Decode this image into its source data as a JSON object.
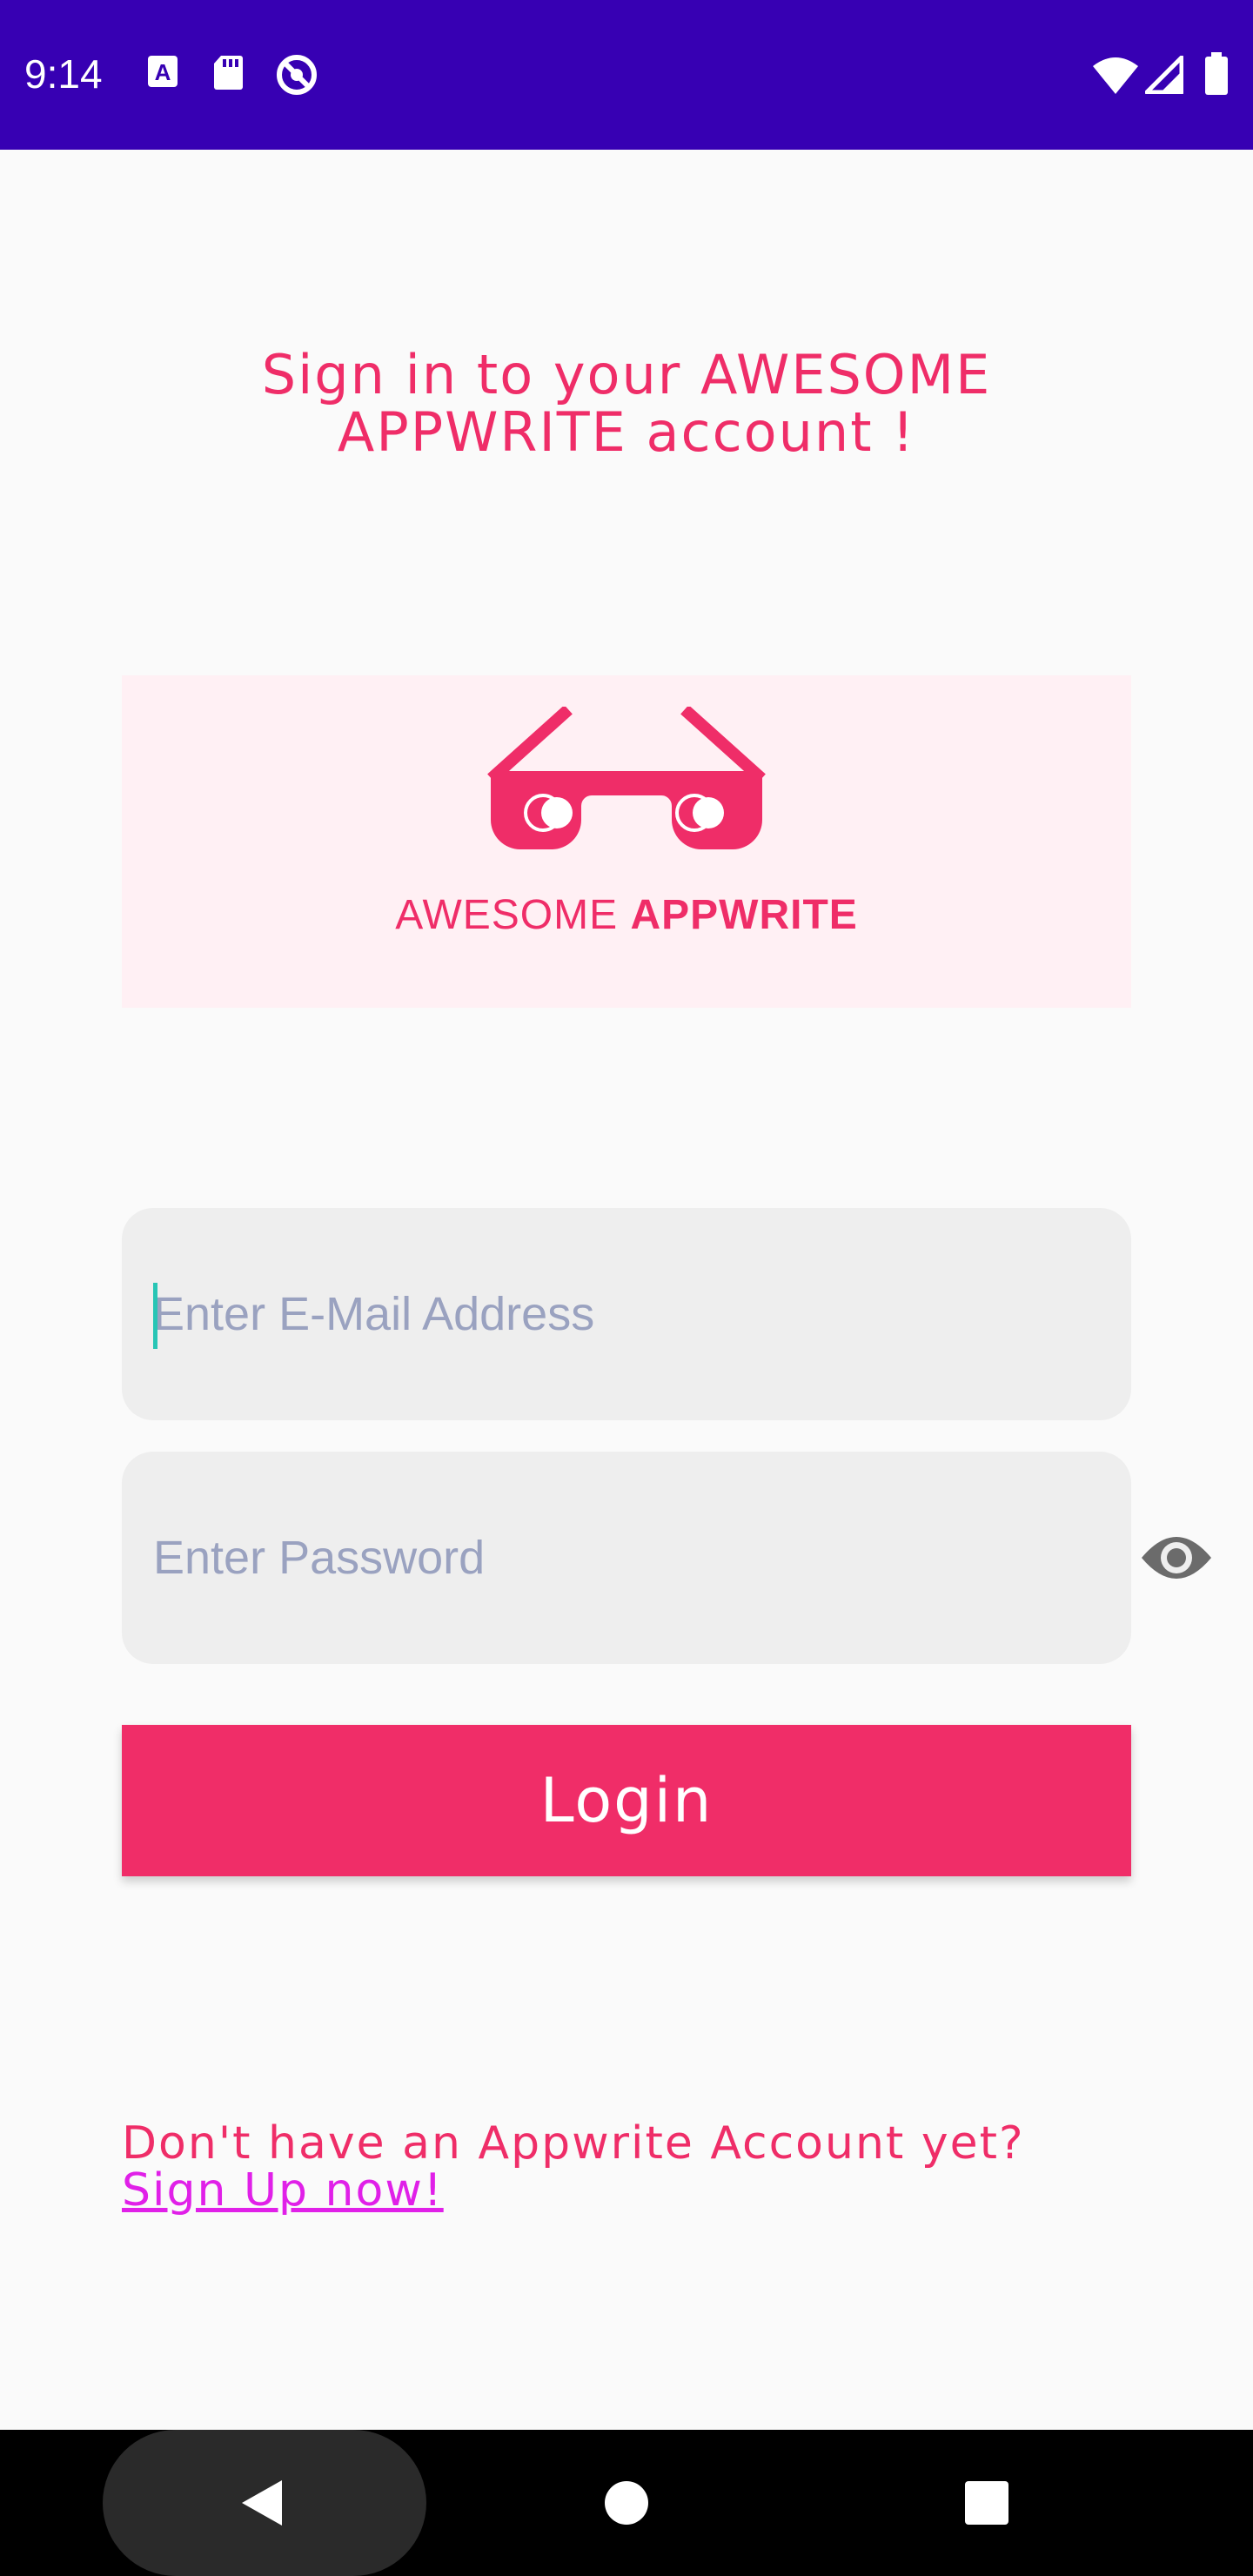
{
  "status_bar": {
    "time": "9:14",
    "left_icons": [
      "a-icon",
      "sd-card-icon",
      "do-not-disturb-icon"
    ],
    "right_icons": [
      "wifi-icon",
      "signal-icon",
      "battery-icon"
    ]
  },
  "colors": {
    "status_bar": "#3700b3",
    "accent": "#ef2d68",
    "link": "#e020e8",
    "field_bg": "#eeeeee",
    "logo_bg": "#fff0f4"
  },
  "header": {
    "title": "Sign in to your AWESOME APPWRITE account !"
  },
  "logo": {
    "icon": "glasses-icon",
    "text_regular": "AWESOME ",
    "text_bold": "APPWRITE"
  },
  "form": {
    "email_placeholder": "Enter E-Mail Address",
    "password_placeholder": "Enter Password",
    "toggle_icon": "eye-icon",
    "login_label": "Login"
  },
  "footer": {
    "prompt": "Don't have an Appwrite Account yet?",
    "signup_link": "Sign Up now!"
  },
  "nav_bar": {
    "buttons": [
      "back-icon",
      "home-icon",
      "recents-icon"
    ]
  }
}
